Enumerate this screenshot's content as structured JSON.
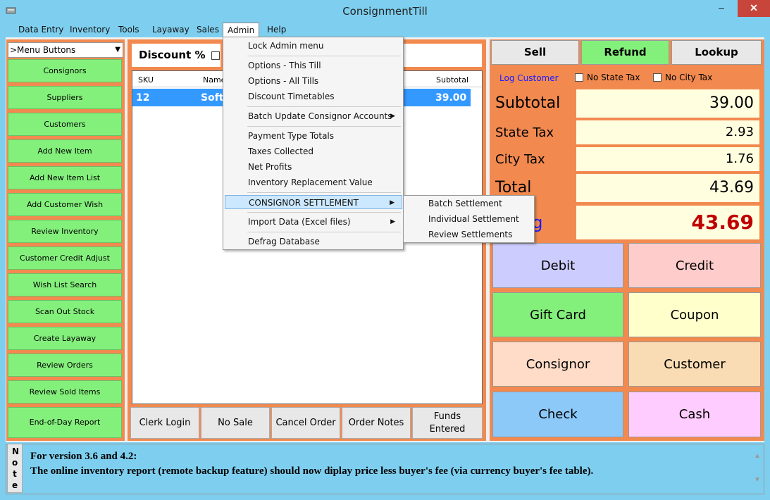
{
  "window": {
    "title": "ConsignmentTill"
  },
  "menubar": [
    "Data Entry",
    "Inventory",
    "Tools",
    "Layaway",
    "Sales",
    "Admin",
    "Help"
  ],
  "left": {
    "combo": ">Menu Buttons",
    "buttons": [
      "Consignors",
      "Suppliers",
      "Customers",
      "Add New Item",
      "Add New Item List",
      "Add Customer Wish",
      "Review Inventory",
      "Customer Credit Adjust",
      "Wish List Search",
      "Scan Out Stock",
      "Create Layaway",
      "Review Orders",
      "Review Sold Items",
      "End-of-Day Report"
    ]
  },
  "middle": {
    "discount_label": "Discount %",
    "grid": {
      "headers": {
        "sku": "SKU",
        "name": "Name",
        "subtotal": "Subtotal"
      },
      "row": {
        "sku": "12",
        "name": "Soft",
        "subtotal": "39.00"
      }
    },
    "bottom_buttons": [
      "Clerk Login",
      "No Sale",
      "Cancel Order",
      "Order Notes",
      "Funds Entered"
    ]
  },
  "admin_menu": {
    "items": [
      "Lock Admin menu",
      "Options - This Till",
      "Options - All Tills",
      "Discount Timetables",
      "Batch Update Consignor Accounts",
      "Payment Type Totals",
      "Taxes Collected",
      "Net Profits",
      "Inventory Replacement Value",
      "CONSIGNOR SETTLEMENT",
      "Import Data (Excel files)",
      "Defrag Database"
    ],
    "submenu": [
      "Batch Settlement",
      "Individual Settlement",
      "Review Settlements"
    ]
  },
  "right": {
    "tabs": {
      "sell": "Sell",
      "refund": "Refund",
      "lookup": "Lookup"
    },
    "log_customer": "Log Customer",
    "no_state_tax": "No State Tax",
    "no_city_tax": "No City Tax",
    "totals": {
      "subtotal_label": "Subtotal",
      "subtotal": "39.00",
      "state_tax_label": "State Tax",
      "state_tax": "2.93",
      "city_tax_label": "City Tax",
      "city_tax": "1.76",
      "total_label": "Total",
      "total": "43.69",
      "owing_label": "ng",
      "owing": "43.69"
    },
    "payments": [
      "Debit",
      "Credit",
      "Gift Card",
      "Coupon",
      "Consignor",
      "Customer",
      "Check",
      "Cash"
    ]
  },
  "note": {
    "label": "Note",
    "line1": "For version 3.6 and 4.2:",
    "line2": "The online inventory report (remote backup feature) should now diplay price less buyer's fee (via currency buyer's fee table)."
  },
  "colors": {
    "accent_green": "#84f07c",
    "panel_orange": "#f28a50",
    "owing_red": "#c00000"
  }
}
